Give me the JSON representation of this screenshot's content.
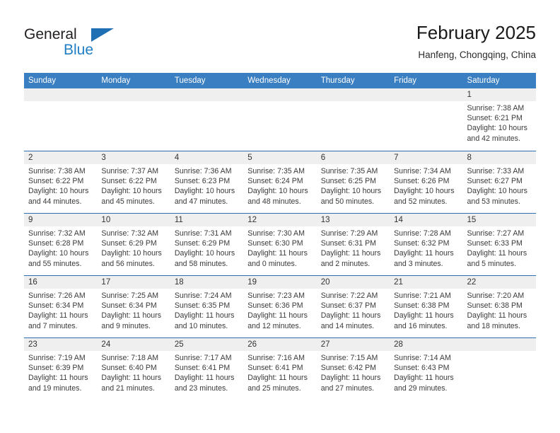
{
  "brand": {
    "name_part1": "General",
    "name_part2": "Blue",
    "triangle_color": "#1f6fb5",
    "blue_color": "#1f7ec4"
  },
  "header": {
    "month_title": "February 2025",
    "location": "Hanfeng, Chongqing, China"
  },
  "theme": {
    "header_bar_color": "#3a7fc1",
    "row_divider_color": "#2f6fae",
    "daynum_band_color": "#efefef"
  },
  "calendar": {
    "weekday_headers": [
      "Sunday",
      "Monday",
      "Tuesday",
      "Wednesday",
      "Thursday",
      "Friday",
      "Saturday"
    ],
    "weeks": [
      [
        {
          "day": "",
          "sunrise": "",
          "sunset": "",
          "daylight": "",
          "daylight2": ""
        },
        {
          "day": "",
          "sunrise": "",
          "sunset": "",
          "daylight": "",
          "daylight2": ""
        },
        {
          "day": "",
          "sunrise": "",
          "sunset": "",
          "daylight": "",
          "daylight2": ""
        },
        {
          "day": "",
          "sunrise": "",
          "sunset": "",
          "daylight": "",
          "daylight2": ""
        },
        {
          "day": "",
          "sunrise": "",
          "sunset": "",
          "daylight": "",
          "daylight2": ""
        },
        {
          "day": "",
          "sunrise": "",
          "sunset": "",
          "daylight": "",
          "daylight2": ""
        },
        {
          "day": "1",
          "sunrise": "Sunrise: 7:38 AM",
          "sunset": "Sunset: 6:21 PM",
          "daylight": "Daylight: 10 hours",
          "daylight2": "and 42 minutes."
        }
      ],
      [
        {
          "day": "2",
          "sunrise": "Sunrise: 7:38 AM",
          "sunset": "Sunset: 6:22 PM",
          "daylight": "Daylight: 10 hours",
          "daylight2": "and 44 minutes."
        },
        {
          "day": "3",
          "sunrise": "Sunrise: 7:37 AM",
          "sunset": "Sunset: 6:22 PM",
          "daylight": "Daylight: 10 hours",
          "daylight2": "and 45 minutes."
        },
        {
          "day": "4",
          "sunrise": "Sunrise: 7:36 AM",
          "sunset": "Sunset: 6:23 PM",
          "daylight": "Daylight: 10 hours",
          "daylight2": "and 47 minutes."
        },
        {
          "day": "5",
          "sunrise": "Sunrise: 7:35 AM",
          "sunset": "Sunset: 6:24 PM",
          "daylight": "Daylight: 10 hours",
          "daylight2": "and 48 minutes."
        },
        {
          "day": "6",
          "sunrise": "Sunrise: 7:35 AM",
          "sunset": "Sunset: 6:25 PM",
          "daylight": "Daylight: 10 hours",
          "daylight2": "and 50 minutes."
        },
        {
          "day": "7",
          "sunrise": "Sunrise: 7:34 AM",
          "sunset": "Sunset: 6:26 PM",
          "daylight": "Daylight: 10 hours",
          "daylight2": "and 52 minutes."
        },
        {
          "day": "8",
          "sunrise": "Sunrise: 7:33 AM",
          "sunset": "Sunset: 6:27 PM",
          "daylight": "Daylight: 10 hours",
          "daylight2": "and 53 minutes."
        }
      ],
      [
        {
          "day": "9",
          "sunrise": "Sunrise: 7:32 AM",
          "sunset": "Sunset: 6:28 PM",
          "daylight": "Daylight: 10 hours",
          "daylight2": "and 55 minutes."
        },
        {
          "day": "10",
          "sunrise": "Sunrise: 7:32 AM",
          "sunset": "Sunset: 6:29 PM",
          "daylight": "Daylight: 10 hours",
          "daylight2": "and 56 minutes."
        },
        {
          "day": "11",
          "sunrise": "Sunrise: 7:31 AM",
          "sunset": "Sunset: 6:29 PM",
          "daylight": "Daylight: 10 hours",
          "daylight2": "and 58 minutes."
        },
        {
          "day": "12",
          "sunrise": "Sunrise: 7:30 AM",
          "sunset": "Sunset: 6:30 PM",
          "daylight": "Daylight: 11 hours",
          "daylight2": "and 0 minutes."
        },
        {
          "day": "13",
          "sunrise": "Sunrise: 7:29 AM",
          "sunset": "Sunset: 6:31 PM",
          "daylight": "Daylight: 11 hours",
          "daylight2": "and 2 minutes."
        },
        {
          "day": "14",
          "sunrise": "Sunrise: 7:28 AM",
          "sunset": "Sunset: 6:32 PM",
          "daylight": "Daylight: 11 hours",
          "daylight2": "and 3 minutes."
        },
        {
          "day": "15",
          "sunrise": "Sunrise: 7:27 AM",
          "sunset": "Sunset: 6:33 PM",
          "daylight": "Daylight: 11 hours",
          "daylight2": "and 5 minutes."
        }
      ],
      [
        {
          "day": "16",
          "sunrise": "Sunrise: 7:26 AM",
          "sunset": "Sunset: 6:34 PM",
          "daylight": "Daylight: 11 hours",
          "daylight2": "and 7 minutes."
        },
        {
          "day": "17",
          "sunrise": "Sunrise: 7:25 AM",
          "sunset": "Sunset: 6:34 PM",
          "daylight": "Daylight: 11 hours",
          "daylight2": "and 9 minutes."
        },
        {
          "day": "18",
          "sunrise": "Sunrise: 7:24 AM",
          "sunset": "Sunset: 6:35 PM",
          "daylight": "Daylight: 11 hours",
          "daylight2": "and 10 minutes."
        },
        {
          "day": "19",
          "sunrise": "Sunrise: 7:23 AM",
          "sunset": "Sunset: 6:36 PM",
          "daylight": "Daylight: 11 hours",
          "daylight2": "and 12 minutes."
        },
        {
          "day": "20",
          "sunrise": "Sunrise: 7:22 AM",
          "sunset": "Sunset: 6:37 PM",
          "daylight": "Daylight: 11 hours",
          "daylight2": "and 14 minutes."
        },
        {
          "day": "21",
          "sunrise": "Sunrise: 7:21 AM",
          "sunset": "Sunset: 6:38 PM",
          "daylight": "Daylight: 11 hours",
          "daylight2": "and 16 minutes."
        },
        {
          "day": "22",
          "sunrise": "Sunrise: 7:20 AM",
          "sunset": "Sunset: 6:38 PM",
          "daylight": "Daylight: 11 hours",
          "daylight2": "and 18 minutes."
        }
      ],
      [
        {
          "day": "23",
          "sunrise": "Sunrise: 7:19 AM",
          "sunset": "Sunset: 6:39 PM",
          "daylight": "Daylight: 11 hours",
          "daylight2": "and 19 minutes."
        },
        {
          "day": "24",
          "sunrise": "Sunrise: 7:18 AM",
          "sunset": "Sunset: 6:40 PM",
          "daylight": "Daylight: 11 hours",
          "daylight2": "and 21 minutes."
        },
        {
          "day": "25",
          "sunrise": "Sunrise: 7:17 AM",
          "sunset": "Sunset: 6:41 PM",
          "daylight": "Daylight: 11 hours",
          "daylight2": "and 23 minutes."
        },
        {
          "day": "26",
          "sunrise": "Sunrise: 7:16 AM",
          "sunset": "Sunset: 6:41 PM",
          "daylight": "Daylight: 11 hours",
          "daylight2": "and 25 minutes."
        },
        {
          "day": "27",
          "sunrise": "Sunrise: 7:15 AM",
          "sunset": "Sunset: 6:42 PM",
          "daylight": "Daylight: 11 hours",
          "daylight2": "and 27 minutes."
        },
        {
          "day": "28",
          "sunrise": "Sunrise: 7:14 AM",
          "sunset": "Sunset: 6:43 PM",
          "daylight": "Daylight: 11 hours",
          "daylight2": "and 29 minutes."
        },
        {
          "day": "",
          "sunrise": "",
          "sunset": "",
          "daylight": "",
          "daylight2": ""
        }
      ]
    ]
  }
}
